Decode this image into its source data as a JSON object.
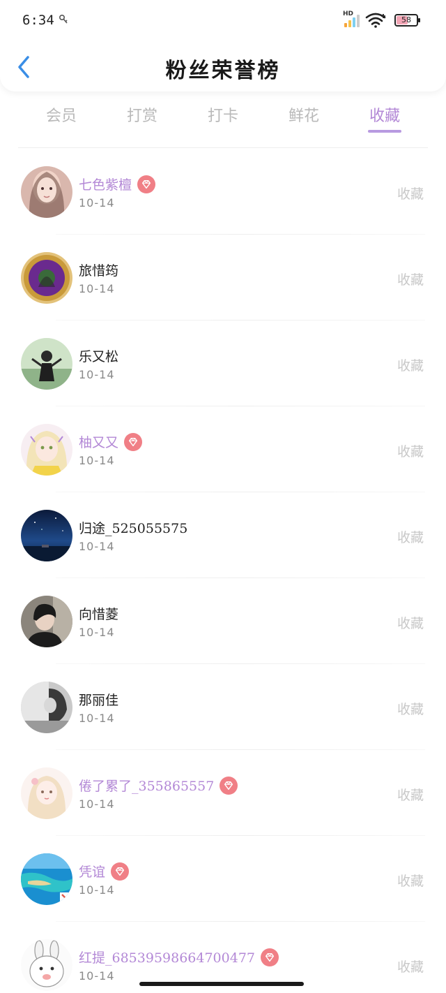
{
  "status_bar": {
    "time": "6:34",
    "network_label": "HD",
    "battery_level": "58",
    "battery_fraction": 0.58
  },
  "header": {
    "title": "粉丝荣誉榜",
    "back_icon": "chevron-left-icon"
  },
  "tabs": [
    {
      "label": "会员",
      "active": false
    },
    {
      "label": "打赏",
      "active": false
    },
    {
      "label": "打卡",
      "active": false
    },
    {
      "label": "鲜花",
      "active": false
    },
    {
      "label": "收藏",
      "active": true
    }
  ],
  "colors": {
    "accent": "#b388d6",
    "vip_badge": "#f07f86",
    "back_arrow": "#3a8ee6",
    "inactive_tab": "#b9b9b9",
    "action_text": "#c8c8c8"
  },
  "fans": [
    {
      "name": "七色紫檀",
      "date": "10-14",
      "action": "收藏",
      "vip": true,
      "avatar": "avatar-pink-girl"
    },
    {
      "name": "旅惜筠",
      "date": "10-14",
      "action": "收藏",
      "vip": false,
      "avatar": "avatar-purple-emblem"
    },
    {
      "name": "乐又松",
      "date": "10-14",
      "action": "收藏",
      "vip": false,
      "avatar": "avatar-outdoor-person"
    },
    {
      "name": "柚又又",
      "date": "10-14",
      "action": "收藏",
      "vip": true,
      "avatar": "avatar-anime-girl"
    },
    {
      "name": "归途_525055575",
      "date": "10-14",
      "action": "收藏",
      "vip": false,
      "avatar": "avatar-night-sky"
    },
    {
      "name": "向惜菱",
      "date": "10-14",
      "action": "收藏",
      "vip": false,
      "avatar": "avatar-dark-hair"
    },
    {
      "name": "那丽佳",
      "date": "10-14",
      "action": "收藏",
      "vip": false,
      "avatar": "avatar-grayscale"
    },
    {
      "name": "倦了累了_355865557",
      "date": "10-14",
      "action": "收藏",
      "vip": true,
      "avatar": "avatar-doll"
    },
    {
      "name": "凭谊",
      "date": "10-14",
      "action": "收藏",
      "vip": true,
      "avatar": "avatar-ocean"
    },
    {
      "name": "红提_685395986647004​77",
      "date": "10-14",
      "action": "收藏",
      "vip": true,
      "avatar": "avatar-rabbit"
    }
  ]
}
